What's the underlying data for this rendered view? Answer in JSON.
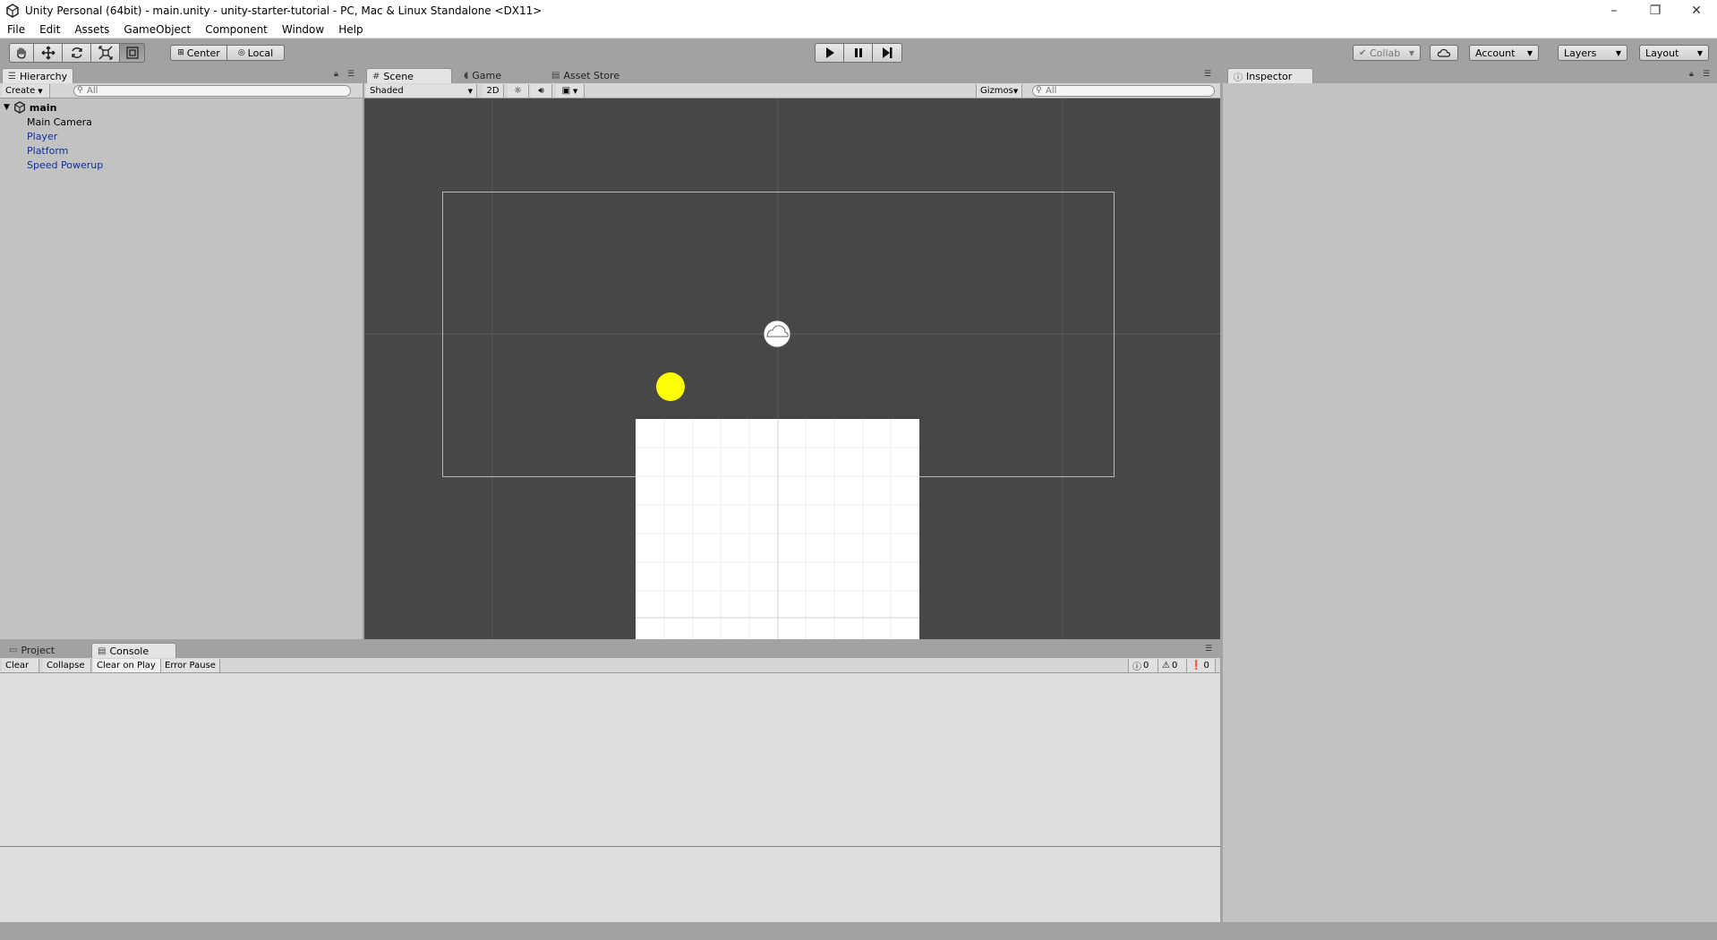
{
  "window": {
    "title": "Unity Personal (64bit) - main.unity - unity-starter-tutorial - PC, Mac & Linux Standalone <DX11>",
    "minimize": "–",
    "restore": "❐",
    "close": "✕"
  },
  "menu": [
    "File",
    "Edit",
    "Assets",
    "GameObject",
    "Component",
    "Window",
    "Help"
  ],
  "toolbar": {
    "pivot_center": "Center",
    "pivot_local": "Local",
    "collab": "Collab",
    "account": "Account",
    "layers": "Layers",
    "layout": "Layout"
  },
  "hierarchy": {
    "tab": "Hierarchy",
    "create": "Create",
    "search_placeholder": "All",
    "scene_name": "main",
    "items": [
      {
        "label": "Main Camera",
        "is_prefab": false
      },
      {
        "label": "Player",
        "is_prefab": true
      },
      {
        "label": "Platform",
        "is_prefab": true
      },
      {
        "label": "Speed Powerup",
        "is_prefab": true
      }
    ]
  },
  "scene": {
    "tabs": [
      "Scene",
      "Game",
      "Asset Store"
    ],
    "shading_mode": "Shaded",
    "mode_2d": "2D",
    "gizmos": "Gizmos",
    "search_placeholder": "All",
    "background_color": "#474747",
    "powerup_color": "#ffff00",
    "platform_color": "#ffffff"
  },
  "inspector": {
    "tab": "Inspector"
  },
  "console": {
    "tabs": [
      "Project",
      "Console"
    ],
    "buttons": [
      "Clear",
      "Collapse",
      "Clear on Play",
      "Error Pause"
    ],
    "info_count": "0",
    "warning_count": "0",
    "error_count": "0"
  }
}
